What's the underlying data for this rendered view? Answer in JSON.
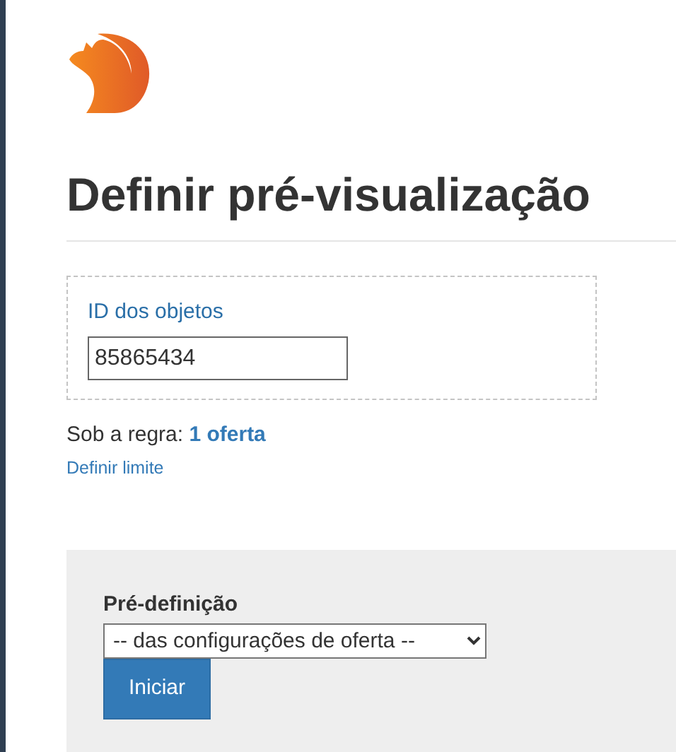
{
  "title": "Definir pré-visualização",
  "objects": {
    "label": "ID dos objetos",
    "value": "85865434"
  },
  "rule": {
    "text": "Sob a regra:",
    "link": "1 oferta"
  },
  "limit_link": "Definir limite",
  "preset": {
    "label": "Pré-definição",
    "value": "-- das configurações de oferta --",
    "button": "Iniciar"
  }
}
